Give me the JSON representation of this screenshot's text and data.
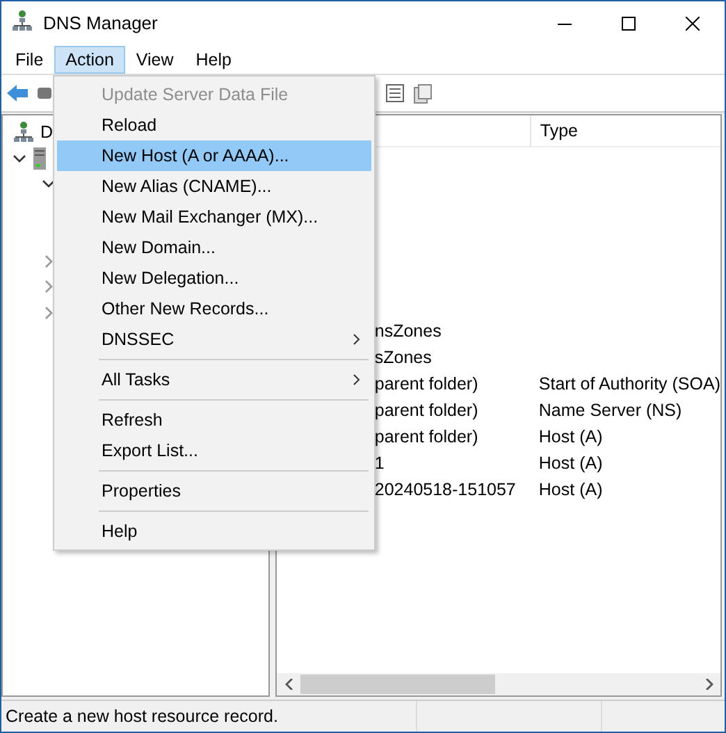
{
  "window": {
    "title": "DNS Manager"
  },
  "menu_bar": [
    {
      "label": "File",
      "selected": false
    },
    {
      "label": "Action",
      "selected": true
    },
    {
      "label": "View",
      "selected": false
    },
    {
      "label": "Help",
      "selected": false
    }
  ],
  "action_menu": [
    {
      "kind": "item",
      "label": "Update Server Data File",
      "disabled": true,
      "selected": false,
      "submenu": false
    },
    {
      "kind": "item",
      "label": "Reload",
      "disabled": false,
      "selected": false,
      "submenu": false
    },
    {
      "kind": "item",
      "label": "New Host (A or AAAA)...",
      "disabled": false,
      "selected": true,
      "submenu": false
    },
    {
      "kind": "item",
      "label": "New Alias (CNAME)...",
      "disabled": false,
      "selected": false,
      "submenu": false
    },
    {
      "kind": "item",
      "label": "New Mail Exchanger (MX)...",
      "disabled": false,
      "selected": false,
      "submenu": false
    },
    {
      "kind": "item",
      "label": "New Domain...",
      "disabled": false,
      "selected": false,
      "submenu": false
    },
    {
      "kind": "item",
      "label": "New Delegation...",
      "disabled": false,
      "selected": false,
      "submenu": false
    },
    {
      "kind": "item",
      "label": "Other New Records...",
      "disabled": false,
      "selected": false,
      "submenu": false
    },
    {
      "kind": "item",
      "label": "DNSSEC",
      "disabled": false,
      "selected": false,
      "submenu": true
    },
    {
      "kind": "separator"
    },
    {
      "kind": "item",
      "label": "All Tasks",
      "disabled": false,
      "selected": false,
      "submenu": true
    },
    {
      "kind": "separator"
    },
    {
      "kind": "item",
      "label": "Refresh",
      "disabled": false,
      "selected": false,
      "submenu": false
    },
    {
      "kind": "item",
      "label": "Export List...",
      "disabled": false,
      "selected": false,
      "submenu": false
    },
    {
      "kind": "separator"
    },
    {
      "kind": "item",
      "label": "Properties",
      "disabled": false,
      "selected": false,
      "submenu": false
    },
    {
      "kind": "separator"
    },
    {
      "kind": "item",
      "label": "Help",
      "disabled": false,
      "selected": false,
      "submenu": false
    }
  ],
  "tree": [
    {
      "label": "D",
      "children": [
        {
          "expanded": true,
          "children": [
            {
              "expanded": true
            },
            {
              "expanded": false
            },
            {
              "expanded": false
            },
            {
              "expanded": false
            }
          ]
        }
      ]
    }
  ],
  "list": {
    "columns": [
      "Type"
    ],
    "rows": [
      {
        "name": "nsZones",
        "type": ""
      },
      {
        "name": "sZones",
        "type": ""
      },
      {
        "name": "parent folder)",
        "type": "Start of Authority (SOA)"
      },
      {
        "name": "parent folder)",
        "type": "Name Server (NS)"
      },
      {
        "name": "parent folder)",
        "type": "Host (A)"
      },
      {
        "name": "1",
        "type": "Host (A)"
      },
      {
        "name": "20240518-151057",
        "type": "Host (A)"
      }
    ]
  },
  "status_bar": {
    "text": "Create a new host resource record."
  }
}
